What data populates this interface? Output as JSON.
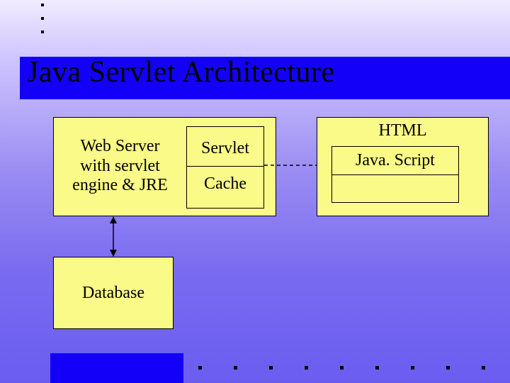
{
  "title": "Java Servlet Architecture",
  "boxes": {
    "webServer": "Web Server with servlet engine & JRE",
    "servlet": "Servlet",
    "cache": "Cache",
    "html": "HTML",
    "javascript": "Java. Script",
    "database": "Database"
  },
  "colors": {
    "titleBar": "#1200f8",
    "box": "#f9fa87"
  },
  "chart_data": {
    "type": "diagram",
    "title": "Java Servlet Architecture",
    "nodes": [
      {
        "id": "webServer",
        "label": "Web Server with servlet engine & JRE"
      },
      {
        "id": "servlet",
        "label": "Servlet",
        "parent": "webServer"
      },
      {
        "id": "cache",
        "label": "Cache",
        "parent": "webServer"
      },
      {
        "id": "htmlClient",
        "label": "HTML"
      },
      {
        "id": "javascript",
        "label": "Java. Script",
        "parent": "htmlClient"
      },
      {
        "id": "database",
        "label": "Database"
      }
    ],
    "edges": [
      {
        "from": "servlet",
        "to": "htmlClient",
        "style": "dashed",
        "directed": false
      },
      {
        "from": "webServer",
        "to": "database",
        "style": "solid",
        "directed": true,
        "bidirectional": true
      }
    ]
  }
}
